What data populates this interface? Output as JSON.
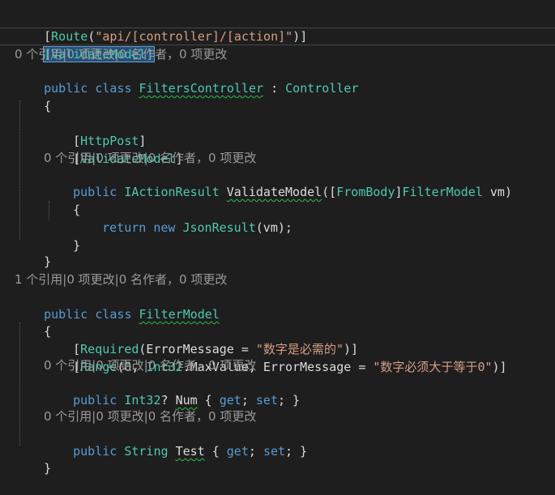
{
  "code": {
    "route_attr_open": "[",
    "route_attr_name": "Route",
    "route_attr_paren_open": "(",
    "route_attr_value": "\"api/[controller]/[action]\"",
    "route_attr_close": ")]",
    "validate_attr_class": "[ValidateModel]",
    "lens_controller_class": "0 个引用|0 项更改|0 名作者，0 项更改",
    "controller_decl_kw": "public class ",
    "controller_name": "FiltersController",
    "controller_colon": " : ",
    "controller_base": "Controller",
    "brace_open_1": "{",
    "httppost_open": "[",
    "httppost_name": "HttpPost",
    "httppost_close": "]",
    "validate_attr_method_open": "[",
    "validate_attr_method_name": "ValidateModel",
    "validate_attr_method_close": "]",
    "lens_method": "0 个引用|0 项更改|0 名作者，0 项更改",
    "method_kw": "public ",
    "method_return_type": "IActionResult",
    "method_name": "ValidateModel",
    "method_params_open": "([",
    "method_param_attr": "FromBody",
    "method_param_close_attr": "]",
    "method_param_type": "FilterModel",
    "method_param_name": " vm)",
    "method_brace_open": "{",
    "return_kw": "return new ",
    "return_type": "JsonResult",
    "return_args": "(vm);",
    "method_brace_close": "}",
    "brace_close_1": "}",
    "lens_model_class": "1 个引用|0 项更改|0 名作者，0 项更改",
    "model_decl_kw": "public class ",
    "model_name": "FilterModel",
    "brace_open_2": "{",
    "required_open": "[",
    "required_name": "Required",
    "required_args_open": "(ErrorMessage = ",
    "required_msg": "\"数字是必需的\"",
    "required_close": ")]",
    "range_open": "[",
    "range_name": "Range",
    "range_args_open": "(",
    "range_num": "0",
    "range_sep": ", ",
    "range_int_type": "Int32",
    "range_max": ".MaxValue, ErrorMessage = ",
    "range_msg": "\"数字必须大于等于0\"",
    "range_close": ")]",
    "lens_num_prop": "0 个引用|0 项更改|0 名作者，0 项更改",
    "num_kw": "public ",
    "num_type": "Int32",
    "num_nullable": "? ",
    "num_name": "Num",
    "num_accessor_open": " { ",
    "num_get": "get",
    "num_semi1": "; ",
    "num_set": "set",
    "num_accessor_close": "; }",
    "lens_test_prop": "0 个引用|0 项更改|0 名作者，0 项更改",
    "test_kw": "public ",
    "test_type": "String",
    "test_space": " ",
    "test_name": "Test",
    "test_accessor_open": " { ",
    "test_get": "get",
    "test_semi1": "; ",
    "test_set": "set",
    "test_accessor_close": "; }",
    "brace_close_2": "}"
  },
  "colors": {
    "background": "#1e1e1e",
    "keyword": "#569cd6",
    "type": "#4ec9b0",
    "string": "#d69d85",
    "number": "#b5cea8",
    "codelens": "#9a9a9a",
    "squiggle": "#2dbd4a"
  }
}
